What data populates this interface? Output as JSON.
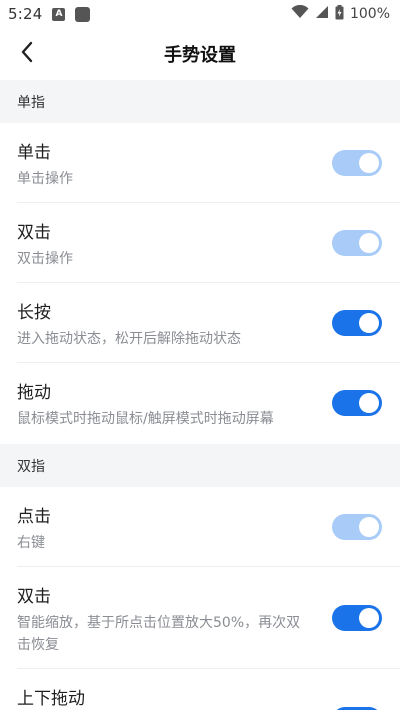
{
  "status_bar": {
    "time": "5:24",
    "notif_letter": "A",
    "battery": "100%"
  },
  "header": {
    "title": "手势设置"
  },
  "sections": [
    {
      "label": "单指",
      "items": [
        {
          "title": "单击",
          "subtitle": "单击操作",
          "on": true,
          "enabled": false
        },
        {
          "title": "双击",
          "subtitle": "双击操作",
          "on": true,
          "enabled": false
        },
        {
          "title": "长按",
          "subtitle": "进入拖动状态，松开后解除拖动状态",
          "on": true,
          "enabled": true
        },
        {
          "title": "拖动",
          "subtitle": "鼠标模式时拖动鼠标/触屏模式时拖动屏幕",
          "on": true,
          "enabled": true
        }
      ]
    },
    {
      "label": "双指",
      "items": [
        {
          "title": "点击",
          "subtitle": "右键",
          "on": true,
          "enabled": false
        },
        {
          "title": "双击",
          "subtitle_line1": "智能缩放，基于所点击位置放大50%，再次双",
          "subtitle_line2": "击恢复",
          "on": true,
          "enabled": true
        },
        {
          "title": "上下拖动",
          "subtitle": "",
          "on": true,
          "enabled": true
        }
      ]
    }
  ],
  "colors": {
    "accent": "#1a73e8",
    "accent_disabled": "#a8cbf7",
    "section_bg": "#f4f5f7",
    "subtitle": "#8a8d93"
  }
}
